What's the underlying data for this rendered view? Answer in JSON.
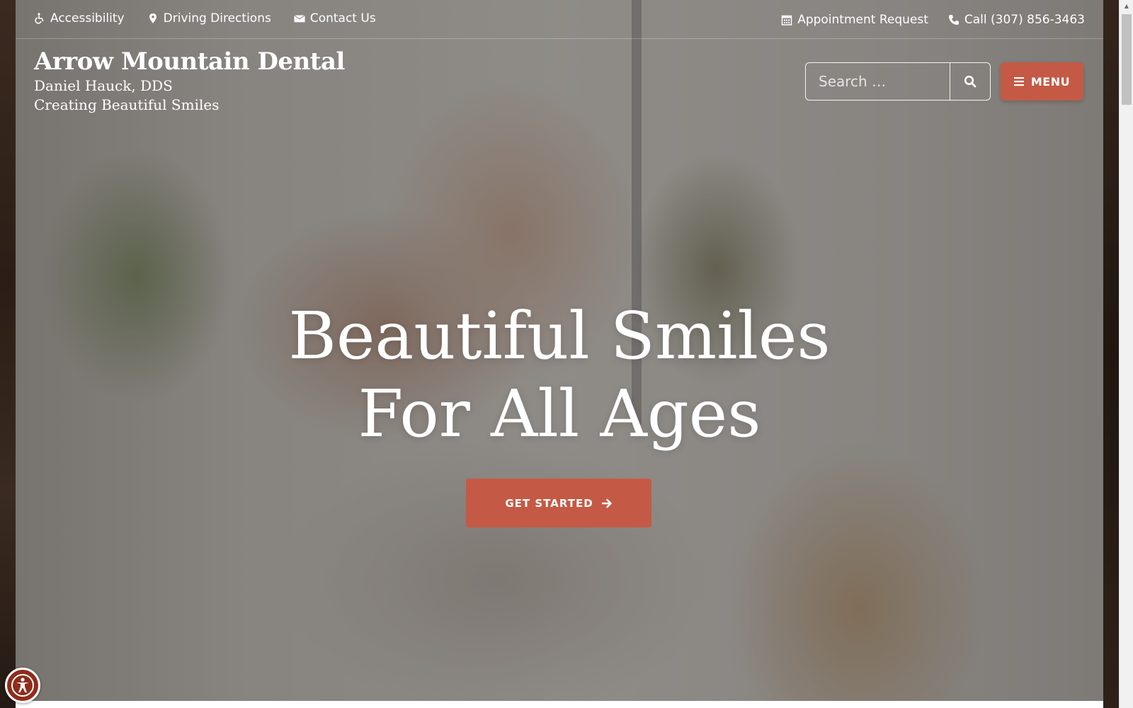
{
  "topbar": {
    "left_links": [
      {
        "label": "Accessibility",
        "icon": "wheelchair-icon"
      },
      {
        "label": "Driving Directions",
        "icon": "map-marker-icon"
      },
      {
        "label": "Contact Us",
        "icon": "envelope-icon"
      }
    ],
    "right_links": [
      {
        "label": "Appointment Request",
        "icon": "calendar-icon"
      },
      {
        "label": "Call (307) 856-3463",
        "icon": "phone-icon"
      }
    ]
  },
  "brand": {
    "name": "Arrow Mountain Dental",
    "doctor": "Daniel Hauck, DDS",
    "tagline": "Creating Beautiful Smiles"
  },
  "search": {
    "placeholder": "Search …",
    "button_icon": "search-icon"
  },
  "menu": {
    "label": "MENU",
    "icon": "hamburger-icon"
  },
  "hero": {
    "headline_line1": "Beautiful Smiles",
    "headline_line2": "For All Ages",
    "cta_label": "GET STARTED",
    "cta_icon": "arrow-right-icon"
  },
  "accessibility_widget": {
    "icon": "accessibility-person-icon"
  },
  "colors": {
    "accent": "#c45a45",
    "widget": "#8f2c1c",
    "text": "#ffffff"
  }
}
